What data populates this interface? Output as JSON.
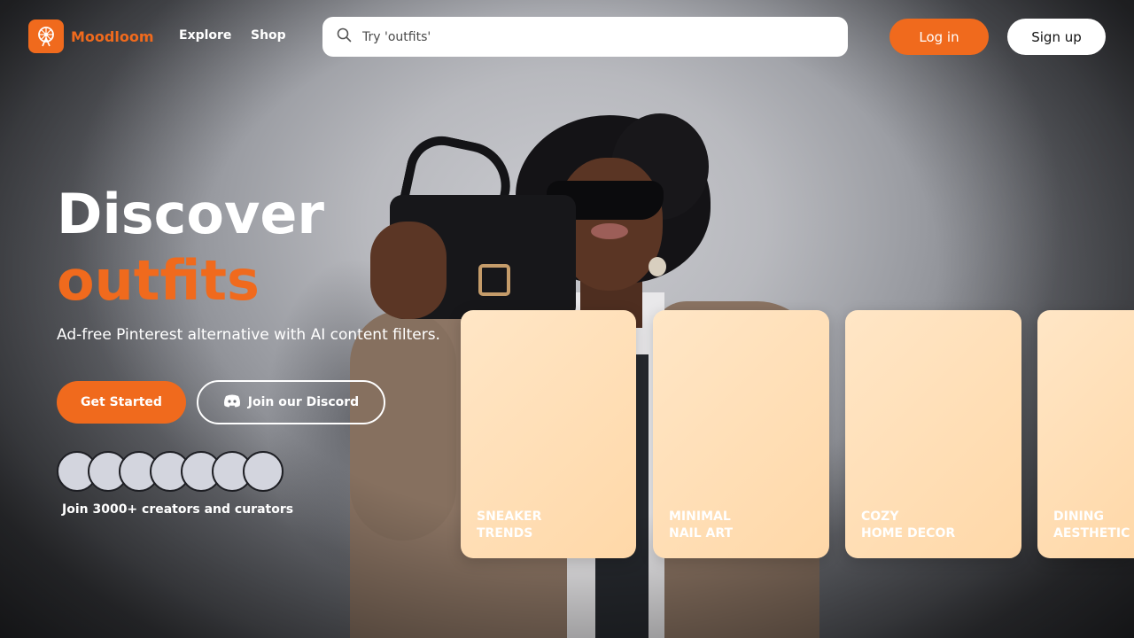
{
  "header": {
    "brand": "Moodloom",
    "nav": [
      "Explore",
      "Shop"
    ],
    "search_placeholder": "Try 'outfits'",
    "login_label": "Log in",
    "signup_label": "Sign up"
  },
  "hero": {
    "headline_line1": "Discover",
    "headline_line2": "outfits",
    "tagline": "Ad-free Pinterest alternative with AI content filters.",
    "cta_primary": "Get Started",
    "cta_secondary": "Join our Discord",
    "social_proof": "Join 3000+ creators and curators"
  },
  "cards": [
    {
      "line1": "SNEAKER",
      "line2": "TRENDS"
    },
    {
      "line1": "MINIMAL",
      "line2": "NAIL ART"
    },
    {
      "line1": "COZY",
      "line2": "HOME DECOR"
    },
    {
      "line1": "DINING",
      "line2": "AESTHETIC"
    }
  ],
  "colors": {
    "accent": "#f06a1d",
    "card": "#ffdfb8"
  },
  "icons": {
    "logo": "ferris-wheel-icon",
    "search": "search-icon",
    "discord": "discord-icon"
  }
}
